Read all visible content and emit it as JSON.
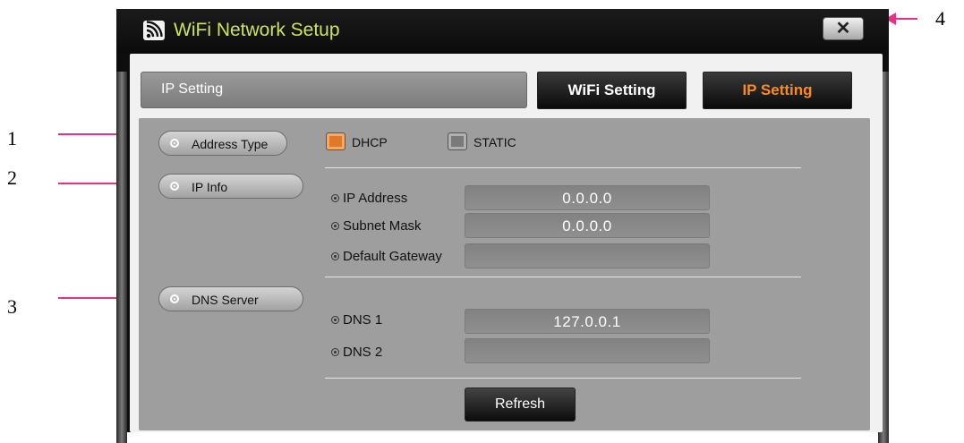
{
  "callouts": [
    "1",
    "2",
    "3",
    "4"
  ],
  "window": {
    "title": "WiFi Network Setup",
    "close_label": "✕"
  },
  "header": {
    "breadcrumb": "IP Setting",
    "tabs": [
      {
        "label": "WiFi Setting",
        "active": false
      },
      {
        "label": "IP Setting",
        "active": true
      }
    ]
  },
  "sections": {
    "address_type": "Address Type",
    "ip_info": "IP Info",
    "dns_server": "DNS Server"
  },
  "address_type": {
    "options": [
      {
        "label": "DHCP",
        "selected": true
      },
      {
        "label": "STATIC",
        "selected": false
      }
    ]
  },
  "ip_info": {
    "fields": [
      {
        "label": "IP Address",
        "value": "0.0.0.0"
      },
      {
        "label": "Subnet Mask",
        "value": "0.0.0.0"
      },
      {
        "label": "Default Gateway",
        "value": ""
      }
    ]
  },
  "dns": {
    "fields": [
      {
        "label": "DNS 1",
        "value": "127.0.0.1"
      },
      {
        "label": "DNS 2",
        "value": ""
      }
    ]
  },
  "refresh_label": "Refresh",
  "colors": {
    "callout_arrow": "#e8308a",
    "title_text": "#cfe35a",
    "active_tab_text": "#ff8a1a",
    "dhcp_selected": "#e0782a"
  },
  "icons": {
    "title": "wifi-icon",
    "close": "close-icon",
    "bullet": "radio-dot-icon"
  }
}
